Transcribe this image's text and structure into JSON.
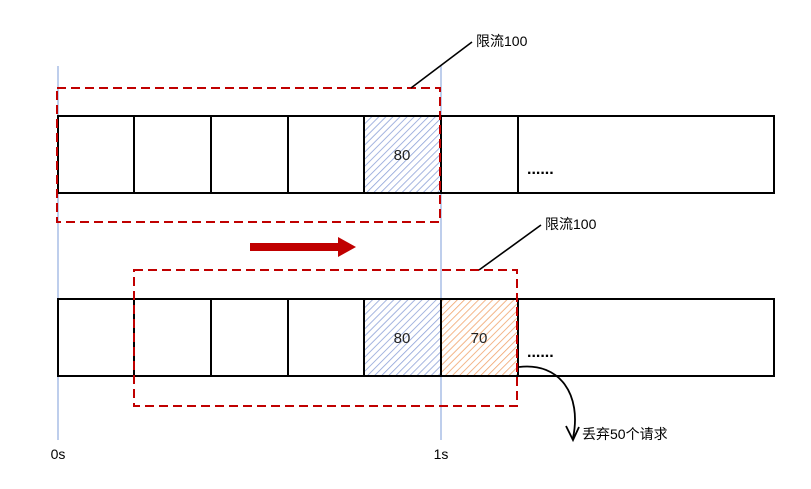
{
  "top_row": {
    "cells": [
      "",
      "",
      "",
      "",
      "80",
      ""
    ],
    "ellipsis": "......"
  },
  "bottom_row": {
    "cells": [
      "",
      "",
      "",
      "",
      "80",
      "70"
    ],
    "ellipsis": "......"
  },
  "labels": {
    "limit_top": "限流100",
    "limit_bottom": "限流100",
    "discard": "丢弃50个请求",
    "axis_start": "0s",
    "axis_end": "1s"
  },
  "colors": {
    "window_border": "#c00000",
    "arrow": "#c00000",
    "hatch_blue": "#8ea2d8",
    "hatch_orange": "#f1a46c",
    "axis_line": "#a9bde6"
  }
}
